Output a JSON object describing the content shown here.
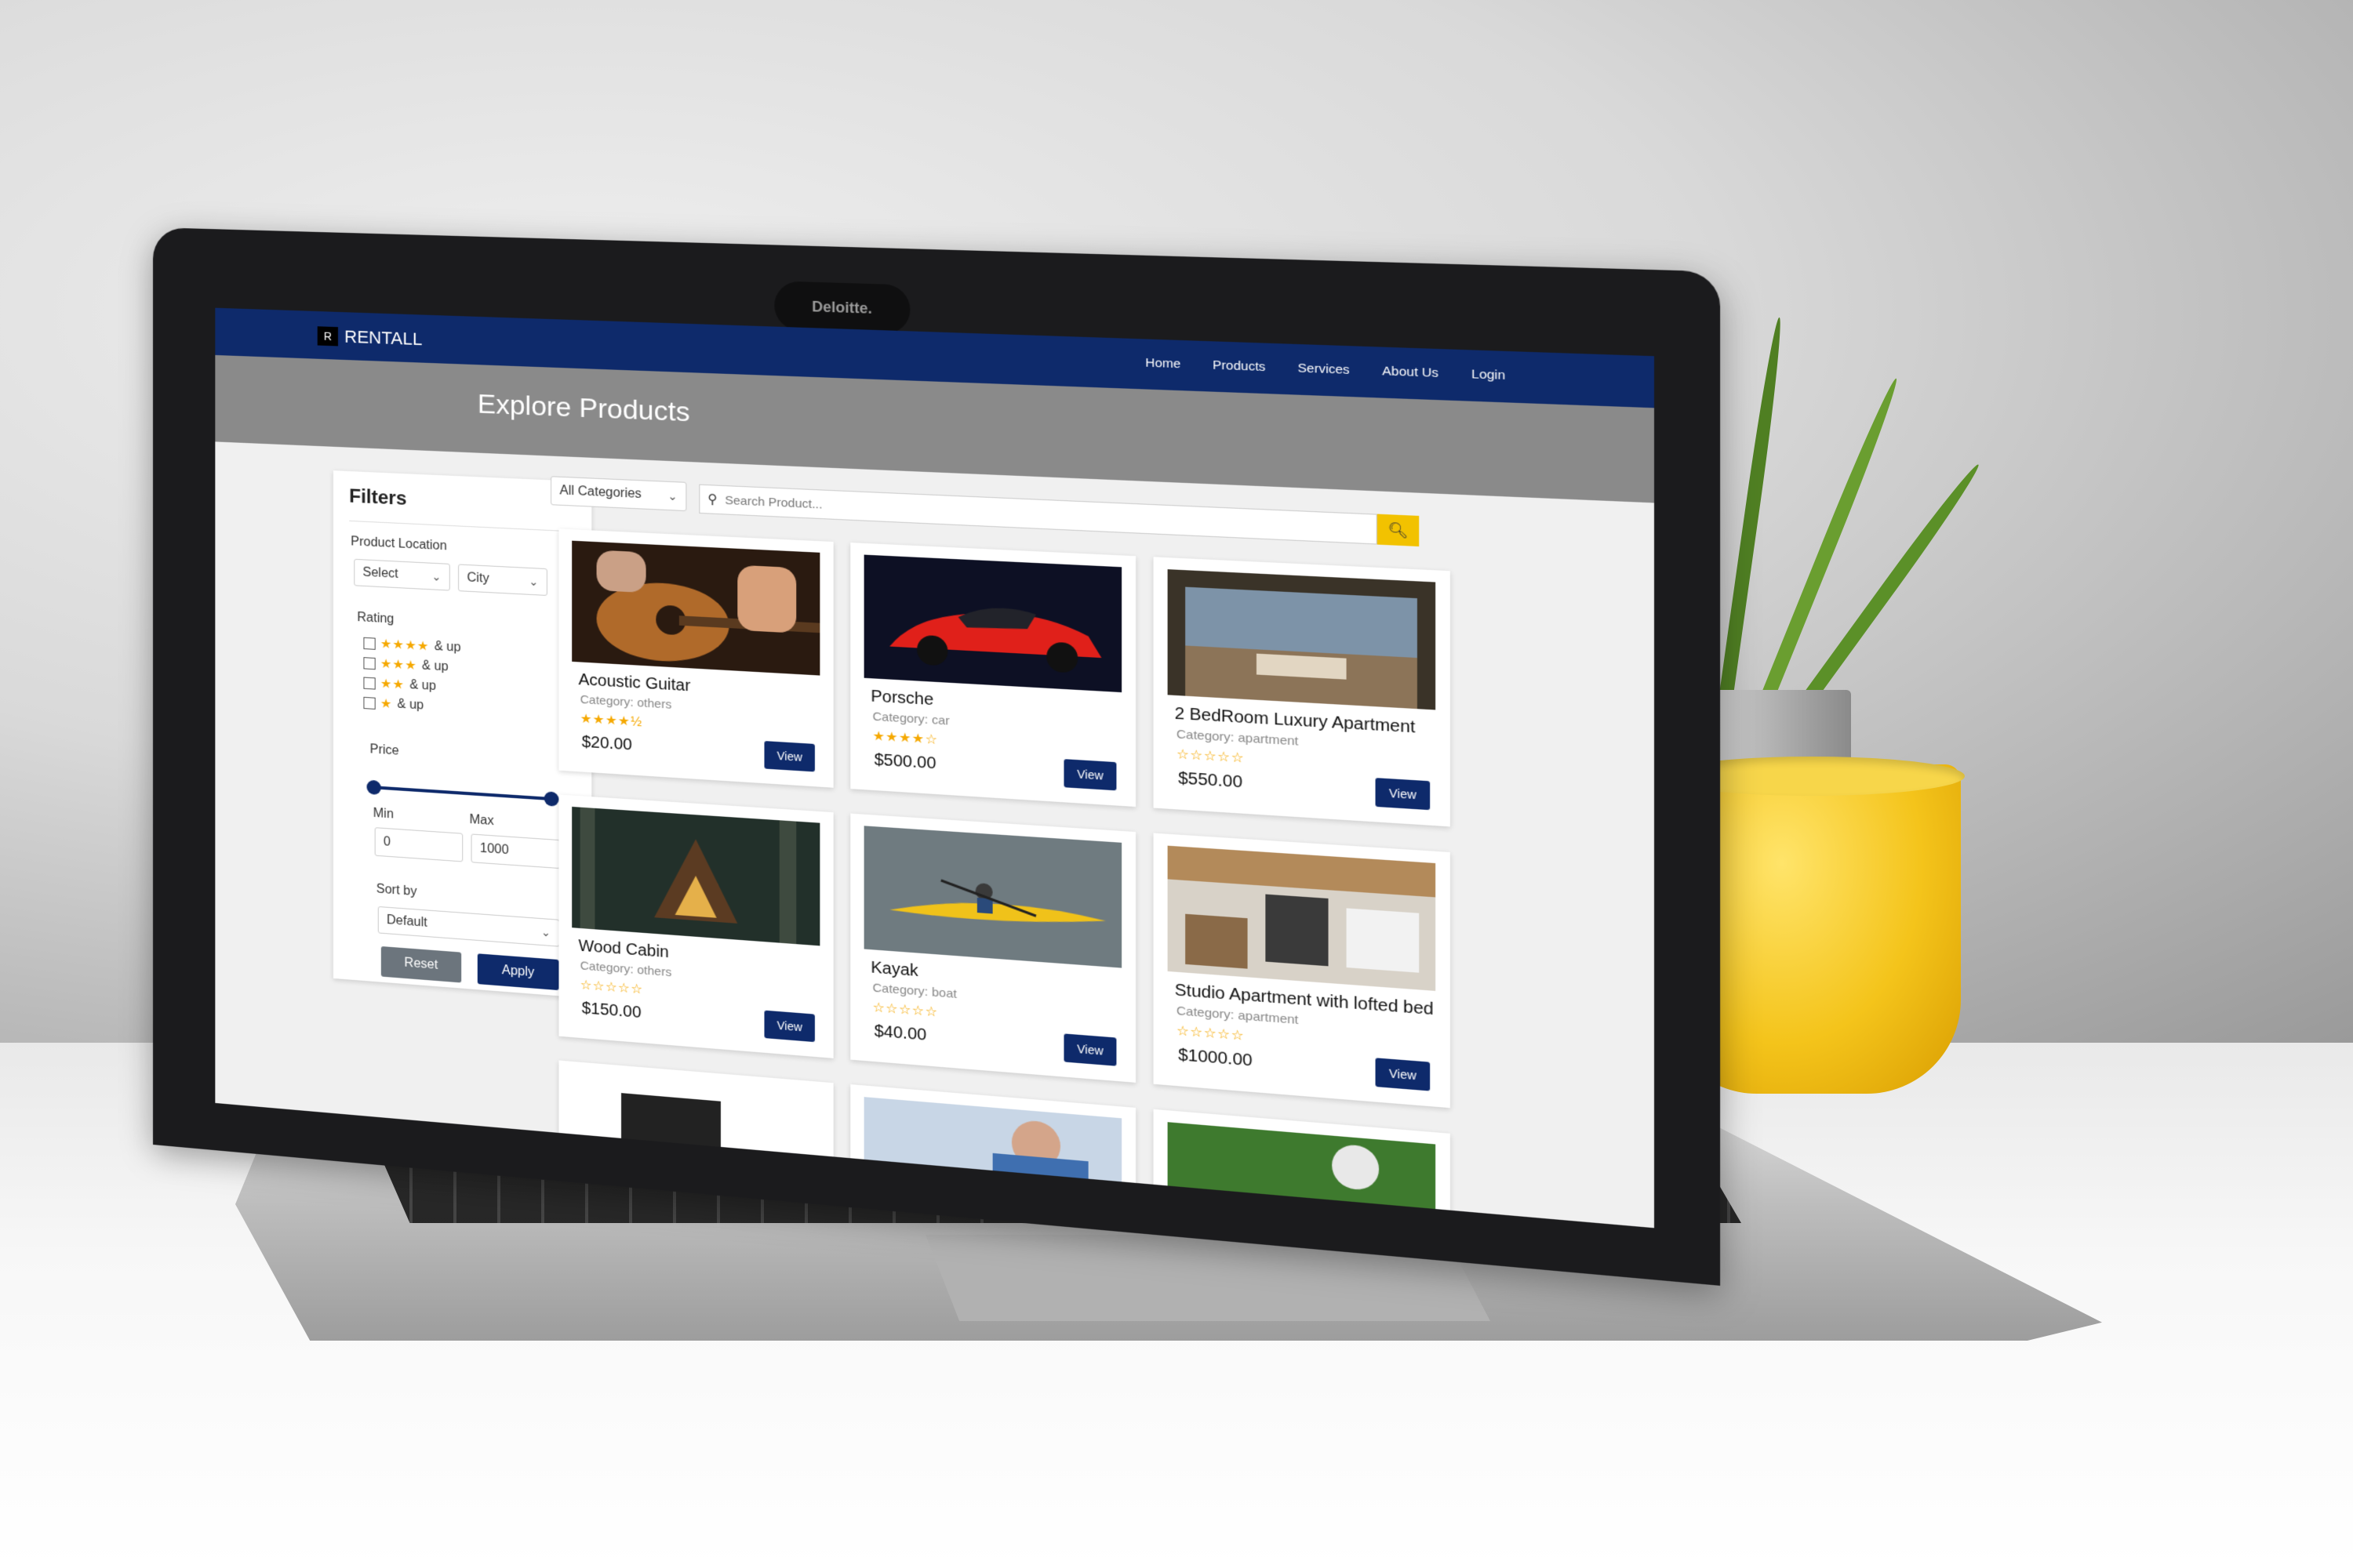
{
  "laptop": {
    "camera_label": "Deloitte."
  },
  "navbar": {
    "brand": "RENTALL",
    "brand_logo": "R",
    "links": [
      "Home",
      "Products",
      "Services",
      "About Us",
      "Login"
    ]
  },
  "hero": {
    "title": "Explore Products"
  },
  "filters": {
    "title": "Filters",
    "location_label": "Product Location",
    "location_select": "Select",
    "city_select": "City",
    "rating_label": "Rating",
    "ratings": [
      {
        "stars": "★★★★",
        "suffix": "& up"
      },
      {
        "stars": "★★★",
        "suffix": "& up"
      },
      {
        "stars": "★★",
        "suffix": "& up"
      },
      {
        "stars": "★",
        "suffix": "& up"
      }
    ],
    "price_label": "Price",
    "min_label": "Min",
    "max_label": "Max",
    "min_value": "0",
    "max_value": "1000",
    "sort_label": "Sort by",
    "sort_value": "Default",
    "reset_label": "Reset",
    "apply_label": "Apply"
  },
  "toolbar": {
    "category": "All Categories",
    "search_placeholder": "Search Product..."
  },
  "colors": {
    "navbar": "#0e2a6b",
    "hero": "#8a8a8a",
    "accent": "#f2c200",
    "star": "#f5a800",
    "reset": "#6c757d"
  },
  "products": [
    {
      "title": "Acoustic Guitar",
      "category": "Category: others",
      "rating": "★★★★½",
      "price": "$20.00",
      "view": "View",
      "image": "guitar-photo"
    },
    {
      "title": "Porsche",
      "category": "Category: car",
      "rating": "★★★★☆",
      "price": "$500.00",
      "view": "View",
      "image": "red-sports-car-photo"
    },
    {
      "title": "2 BedRoom Luxury Apartment",
      "category": "Category: apartment",
      "rating": "☆☆☆☆☆",
      "price": "$550.00",
      "view": "View",
      "image": "apartment-interior-photo"
    },
    {
      "title": "Wood Cabin",
      "category": "Category: others",
      "rating": "☆☆☆☆☆",
      "price": "$150.00",
      "view": "View",
      "image": "forest-cabin-photo"
    },
    {
      "title": "Kayak",
      "category": "Category: boat",
      "rating": "☆☆☆☆☆",
      "price": "$40.00",
      "view": "View",
      "image": "kayak-photo"
    },
    {
      "title": "Studio Apartment with lofted bed",
      "category": "Category: apartment",
      "rating": "☆☆☆☆☆",
      "price": "$1000.00",
      "view": "View",
      "image": "studio-apartment-photo"
    }
  ]
}
